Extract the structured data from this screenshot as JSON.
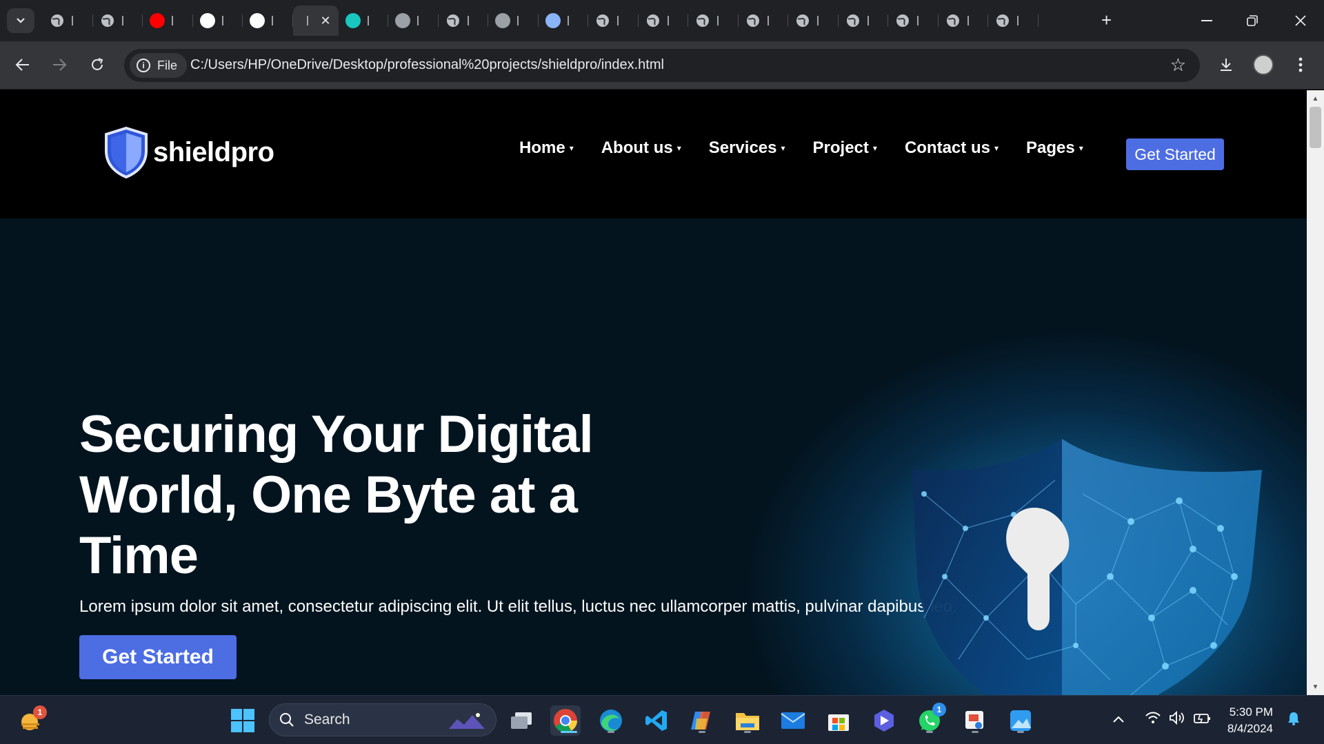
{
  "browser": {
    "tab_count": 20,
    "active_tab_close": "✕",
    "new_tab": "+",
    "window_controls": [
      "minimize-icon",
      "restore-icon",
      "close-icon"
    ],
    "address_chip": "File",
    "url": "C:/Users/HP/OneDrive/Desktop/professional%20projects/shieldpro/index.html"
  },
  "site": {
    "brand": "shieldpro",
    "nav": [
      {
        "label": "Home"
      },
      {
        "label": "About us"
      },
      {
        "label": "Services"
      },
      {
        "label": "Project"
      },
      {
        "label": "Contact us"
      },
      {
        "label": "Pages"
      }
    ],
    "nav_cta": "Get Started",
    "hero": {
      "title": "Securing Your Digital World, One Byte at a Time",
      "subtitle": "Lorem ipsum dolor sit amet, consectetur adipiscing elit. Ut elit tellus, luctus nec ullamcorper mattis, pulvinar dapibus leo.",
      "button": "Get Started"
    },
    "accent_color": "#4d6de3"
  },
  "taskbar": {
    "search_placeholder": "Search",
    "weather_badge": "1",
    "whatsapp_badge": "1",
    "time": "5:30 PM",
    "date": "8/4/2024"
  }
}
